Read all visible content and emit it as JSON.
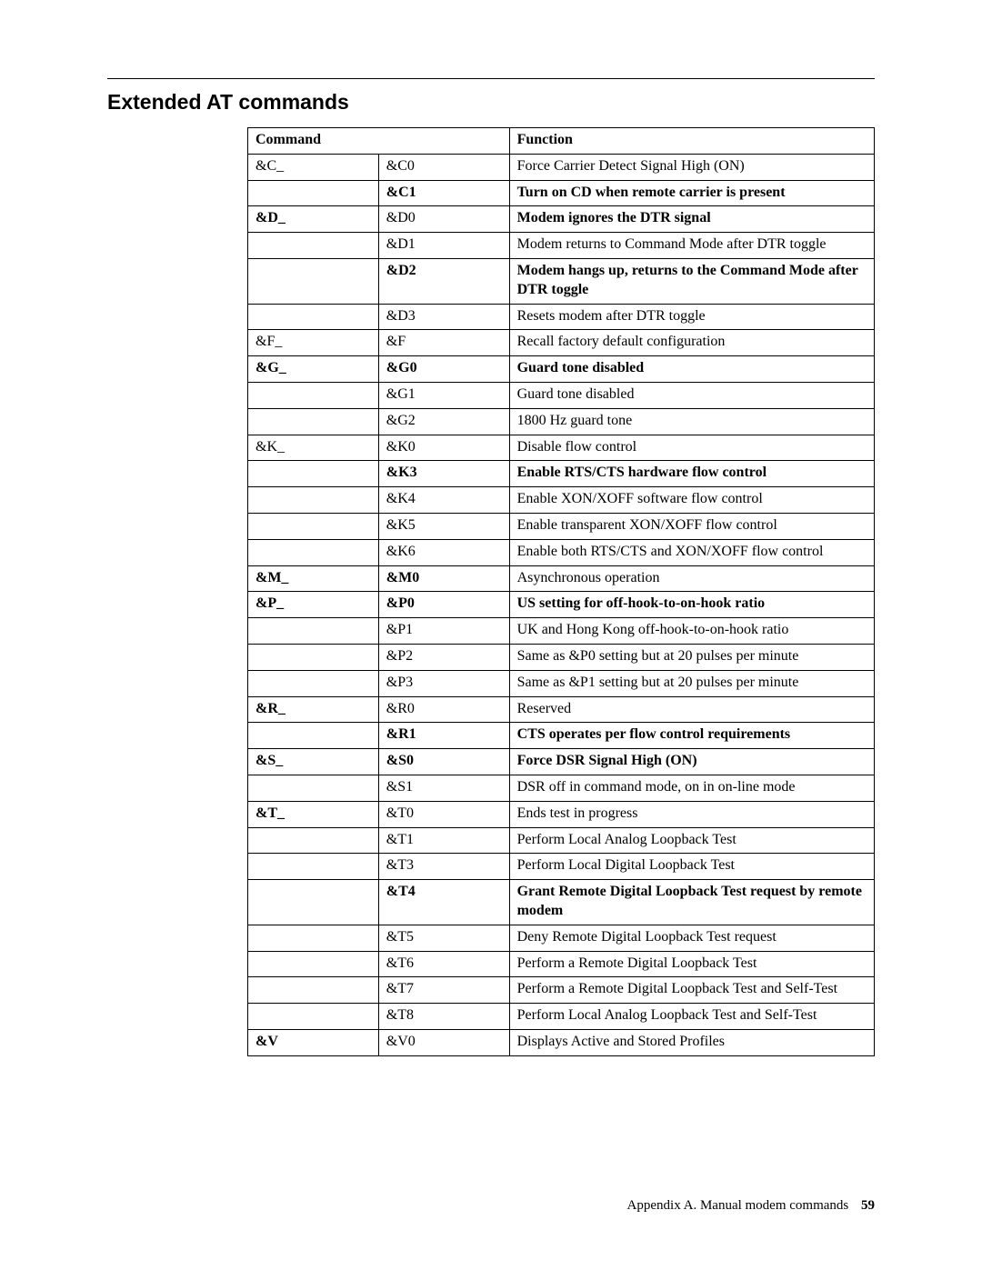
{
  "title": "Extended AT commands",
  "headers": {
    "command": "Command",
    "function": "Function"
  },
  "rows": [
    {
      "group": "&C_",
      "code": "&C0",
      "func": "Force Carrier Detect Signal High (ON)"
    },
    {
      "group": "",
      "code": "&C1",
      "func": "Turn on CD when remote carrier is present",
      "bold_code": true,
      "bold_func": true
    },
    {
      "group": "&D_",
      "code": "&D0",
      "func": "Modem ignores the DTR signal",
      "bold_group": true,
      "bold_func": true
    },
    {
      "group": "",
      "code": "&D1",
      "func": "Modem returns to Command Mode after DTR toggle"
    },
    {
      "group": "",
      "code": "&D2",
      "func": "Modem hangs up, returns to the Command Mode after DTR toggle",
      "bold_code": true,
      "bold_func": true
    },
    {
      "group": "",
      "code": "&D3",
      "func": "Resets modem after DTR toggle"
    },
    {
      "group": "&F_",
      "code": "&F",
      "func": "Recall factory default configuration"
    },
    {
      "group": "&G_",
      "code": "&G0",
      "func": "Guard tone disabled",
      "bold_group": true,
      "bold_code": true,
      "bold_func": true
    },
    {
      "group": "",
      "code": "&G1",
      "func": "Guard tone disabled"
    },
    {
      "group": "",
      "code": "&G2",
      "func": "1800 Hz guard tone"
    },
    {
      "group": "&K_",
      "code": "&K0",
      "func": "Disable flow control"
    },
    {
      "group": "",
      "code": "&K3",
      "func": "Enable RTS/CTS hardware flow control",
      "bold_code": true,
      "bold_func": true
    },
    {
      "group": "",
      "code": "&K4",
      "func": "Enable XON/XOFF software flow control"
    },
    {
      "group": "",
      "code": "&K5",
      "func": "Enable transparent XON/XOFF flow control"
    },
    {
      "group": "",
      "code": "&K6",
      "func": "Enable both RTS/CTS and XON/XOFF flow control"
    },
    {
      "group": "&M_",
      "code": "&M0",
      "func": "Asynchronous operation",
      "bold_group": true,
      "bold_code": true
    },
    {
      "group": "&P_",
      "code": "&P0",
      "func": "US setting for off-hook-to-on-hook ratio",
      "bold_group": true,
      "bold_code": true,
      "bold_func": true
    },
    {
      "group": "",
      "code": "&P1",
      "func": "UK and Hong Kong off-hook-to-on-hook ratio"
    },
    {
      "group": "",
      "code": "&P2",
      "func": "Same as &P0 setting but at 20 pulses per minute"
    },
    {
      "group": "",
      "code": "&P3",
      "func": "Same as &P1 setting but at 20 pulses per minute"
    },
    {
      "group": "&R_",
      "code": "&R0",
      "func": "Reserved",
      "bold_group": true
    },
    {
      "group": "",
      "code": "&R1",
      "func": "CTS operates per flow control requirements",
      "bold_code": true,
      "bold_func": true
    },
    {
      "group": "&S_",
      "code": "&S0",
      "func": "Force DSR Signal High (ON)",
      "bold_group": true,
      "bold_code": true,
      "bold_func": true
    },
    {
      "group": "",
      "code": "&S1",
      "func": "DSR off in command mode, on in on-line mode"
    },
    {
      "group": "&T_",
      "code": "&T0",
      "func": "Ends test in progress",
      "bold_group": true
    },
    {
      "group": "",
      "code": "&T1",
      "func": "Perform Local Analog Loopback Test"
    },
    {
      "group": "",
      "code": "&T3",
      "func": "Perform Local Digital Loopback Test"
    },
    {
      "group": "",
      "code": "&T4",
      "func": "Grant Remote Digital Loopback Test request by remote modem",
      "bold_code": true,
      "bold_func": true
    },
    {
      "group": "",
      "code": "&T5",
      "func": "Deny Remote Digital Loopback Test request"
    },
    {
      "group": "",
      "code": "&T6",
      "func": "Perform a Remote Digital Loopback Test"
    },
    {
      "group": "",
      "code": "&T7",
      "func": "Perform a Remote Digital Loopback Test and Self-Test"
    },
    {
      "group": "",
      "code": "&T8",
      "func": "Perform Local Analog Loopback Test and Self-Test"
    },
    {
      "group": "&V",
      "code": "&V0",
      "func": "Displays Active and Stored Profiles",
      "bold_group": true
    }
  ],
  "footer": {
    "text": "Appendix A. Manual modem commands",
    "page": "59"
  }
}
